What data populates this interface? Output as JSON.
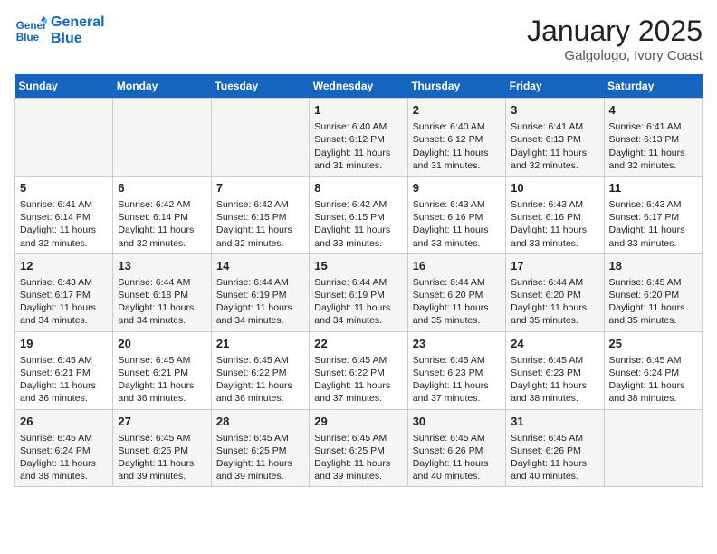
{
  "logo": {
    "line1": "General",
    "line2": "Blue"
  },
  "title": "January 2025",
  "subtitle": "Galgologo, Ivory Coast",
  "days_of_week": [
    "Sunday",
    "Monday",
    "Tuesday",
    "Wednesday",
    "Thursday",
    "Friday",
    "Saturday"
  ],
  "weeks": [
    [
      {
        "day": "",
        "info": ""
      },
      {
        "day": "",
        "info": ""
      },
      {
        "day": "",
        "info": ""
      },
      {
        "day": "1",
        "info": "Sunrise: 6:40 AM\nSunset: 6:12 PM\nDaylight: 11 hours and 31 minutes."
      },
      {
        "day": "2",
        "info": "Sunrise: 6:40 AM\nSunset: 6:12 PM\nDaylight: 11 hours and 31 minutes."
      },
      {
        "day": "3",
        "info": "Sunrise: 6:41 AM\nSunset: 6:13 PM\nDaylight: 11 hours and 32 minutes."
      },
      {
        "day": "4",
        "info": "Sunrise: 6:41 AM\nSunset: 6:13 PM\nDaylight: 11 hours and 32 minutes."
      }
    ],
    [
      {
        "day": "5",
        "info": "Sunrise: 6:41 AM\nSunset: 6:14 PM\nDaylight: 11 hours and 32 minutes."
      },
      {
        "day": "6",
        "info": "Sunrise: 6:42 AM\nSunset: 6:14 PM\nDaylight: 11 hours and 32 minutes."
      },
      {
        "day": "7",
        "info": "Sunrise: 6:42 AM\nSunset: 6:15 PM\nDaylight: 11 hours and 32 minutes."
      },
      {
        "day": "8",
        "info": "Sunrise: 6:42 AM\nSunset: 6:15 PM\nDaylight: 11 hours and 33 minutes."
      },
      {
        "day": "9",
        "info": "Sunrise: 6:43 AM\nSunset: 6:16 PM\nDaylight: 11 hours and 33 minutes."
      },
      {
        "day": "10",
        "info": "Sunrise: 6:43 AM\nSunset: 6:16 PM\nDaylight: 11 hours and 33 minutes."
      },
      {
        "day": "11",
        "info": "Sunrise: 6:43 AM\nSunset: 6:17 PM\nDaylight: 11 hours and 33 minutes."
      }
    ],
    [
      {
        "day": "12",
        "info": "Sunrise: 6:43 AM\nSunset: 6:17 PM\nDaylight: 11 hours and 34 minutes."
      },
      {
        "day": "13",
        "info": "Sunrise: 6:44 AM\nSunset: 6:18 PM\nDaylight: 11 hours and 34 minutes."
      },
      {
        "day": "14",
        "info": "Sunrise: 6:44 AM\nSunset: 6:19 PM\nDaylight: 11 hours and 34 minutes."
      },
      {
        "day": "15",
        "info": "Sunrise: 6:44 AM\nSunset: 6:19 PM\nDaylight: 11 hours and 34 minutes."
      },
      {
        "day": "16",
        "info": "Sunrise: 6:44 AM\nSunset: 6:20 PM\nDaylight: 11 hours and 35 minutes."
      },
      {
        "day": "17",
        "info": "Sunrise: 6:44 AM\nSunset: 6:20 PM\nDaylight: 11 hours and 35 minutes."
      },
      {
        "day": "18",
        "info": "Sunrise: 6:45 AM\nSunset: 6:20 PM\nDaylight: 11 hours and 35 minutes."
      }
    ],
    [
      {
        "day": "19",
        "info": "Sunrise: 6:45 AM\nSunset: 6:21 PM\nDaylight: 11 hours and 36 minutes."
      },
      {
        "day": "20",
        "info": "Sunrise: 6:45 AM\nSunset: 6:21 PM\nDaylight: 11 hours and 36 minutes."
      },
      {
        "day": "21",
        "info": "Sunrise: 6:45 AM\nSunset: 6:22 PM\nDaylight: 11 hours and 36 minutes."
      },
      {
        "day": "22",
        "info": "Sunrise: 6:45 AM\nSunset: 6:22 PM\nDaylight: 11 hours and 37 minutes."
      },
      {
        "day": "23",
        "info": "Sunrise: 6:45 AM\nSunset: 6:23 PM\nDaylight: 11 hours and 37 minutes."
      },
      {
        "day": "24",
        "info": "Sunrise: 6:45 AM\nSunset: 6:23 PM\nDaylight: 11 hours and 38 minutes."
      },
      {
        "day": "25",
        "info": "Sunrise: 6:45 AM\nSunset: 6:24 PM\nDaylight: 11 hours and 38 minutes."
      }
    ],
    [
      {
        "day": "26",
        "info": "Sunrise: 6:45 AM\nSunset: 6:24 PM\nDaylight: 11 hours and 38 minutes."
      },
      {
        "day": "27",
        "info": "Sunrise: 6:45 AM\nSunset: 6:25 PM\nDaylight: 11 hours and 39 minutes."
      },
      {
        "day": "28",
        "info": "Sunrise: 6:45 AM\nSunset: 6:25 PM\nDaylight: 11 hours and 39 minutes."
      },
      {
        "day": "29",
        "info": "Sunrise: 6:45 AM\nSunset: 6:25 PM\nDaylight: 11 hours and 39 minutes."
      },
      {
        "day": "30",
        "info": "Sunrise: 6:45 AM\nSunset: 6:26 PM\nDaylight: 11 hours and 40 minutes."
      },
      {
        "day": "31",
        "info": "Sunrise: 6:45 AM\nSunset: 6:26 PM\nDaylight: 11 hours and 40 minutes."
      },
      {
        "day": "",
        "info": ""
      }
    ]
  ]
}
